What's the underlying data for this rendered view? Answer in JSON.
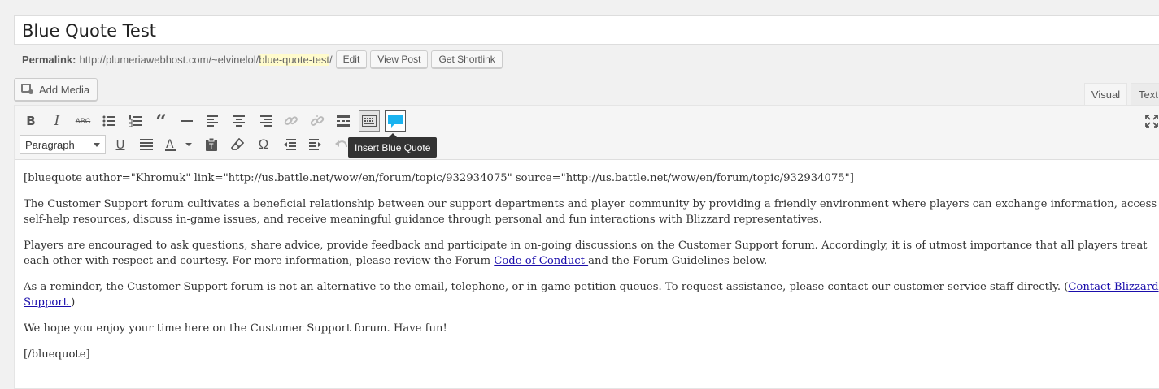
{
  "post": {
    "title": "Blue Quote Test"
  },
  "permalink": {
    "label": "Permalink:",
    "base": "http://plumeriawebhost.com/~elvinelol/",
    "slug": "blue-quote-test",
    "trail": "/",
    "buttons": [
      "Edit",
      "View Post",
      "Get Shortlink"
    ]
  },
  "media": {
    "add_media_label": "Add Media",
    "icon": "camera-music-icon"
  },
  "tabs": {
    "visual": "Visual",
    "text": "Text"
  },
  "toolbar": {
    "row1_icons": [
      "bold-icon",
      "italic-icon",
      "strikethrough-icon",
      "bulleted-list-icon",
      "numbered-list-icon",
      "blockquote-icon",
      "horizontal-rule-icon",
      "align-left-icon",
      "align-center-icon",
      "align-right-icon",
      "insert-link-icon",
      "remove-link-icon",
      "read-more-icon",
      "toolbar-toggle-icon",
      "insert-blue-quote-icon",
      "fullscreen-icon"
    ],
    "row2_icons": [
      "underline-icon",
      "justify-icon",
      "text-color-icon",
      "paste-as-text-icon",
      "clear-formatting-icon",
      "special-character-icon",
      "outdent-icon",
      "indent-icon",
      "undo-icon"
    ],
    "format_select": "Paragraph",
    "tooltip": "Insert Blue Quote",
    "accent_color": "#1ab3f0"
  },
  "content": {
    "shortcode_open": "[bluequote author=\"Khromuk\" link=\"http://us.battle.net/wow/en/forum/topic/932934075\" source=\"http://us.battle.net/wow/en/forum/topic/932934075\"]",
    "p1": "The Customer Support forum cultivates a beneficial relationship between our support departments and player community by providing a friendly environment where players can exchange information, access self-help resources, discuss in-game issues, and receive meaningful guidance through personal and fun interactions with Blizzard representatives.",
    "p2_before": "Players are encouraged to ask questions, share advice, provide feedback and participate in on-going discussions on the Customer Support forum. Accordingly, it is of utmost importance that all players treat each other with respect and courtesy. For more information, please review the Forum ",
    "p2_link": "Code of Conduct ",
    "p2_after": "and the Forum Guidelines below.",
    "p3_before": "As a reminder, the Customer Support forum is not an alternative to the email, telephone, or in-game petition queues. To request assistance, please contact our customer service staff directly. (",
    "p3_link": "Contact Blizzard Support ",
    "p3_after": ")",
    "p4": "We hope you enjoy your time here on the Customer Support forum. Have fun!",
    "shortcode_close": "[/bluequote]"
  }
}
